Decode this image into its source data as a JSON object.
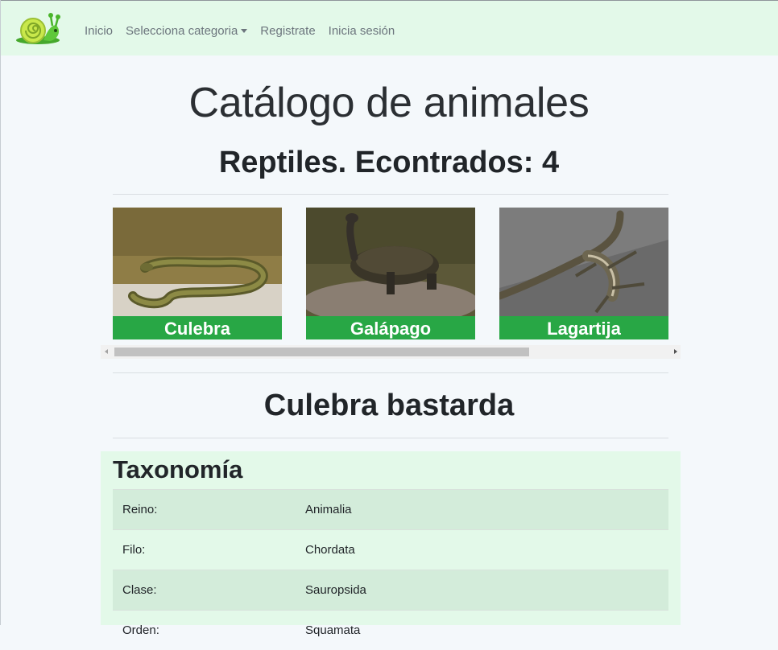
{
  "nav": {
    "links": [
      "Inicio",
      "Selecciona categoria",
      "Registrate",
      "Inicia sesión"
    ]
  },
  "page": {
    "title": "Catálogo de animales",
    "subtitle": "Reptiles. Econtrados: 4"
  },
  "gallery": {
    "cards": [
      {
        "label": "Culebra",
        "icon": "snake-photo"
      },
      {
        "label": "Galápago",
        "icon": "turtle-photo"
      },
      {
        "label": "Lagartija",
        "icon": "lizard-photo"
      }
    ]
  },
  "animal": {
    "name": "Culebra bastarda"
  },
  "taxonomy": {
    "title": "Taxonomía",
    "rows": [
      {
        "key": "Reino:",
        "value": "Animalia"
      },
      {
        "key": "Filo:",
        "value": "Chordata"
      },
      {
        "key": "Clase:",
        "value": "Sauropsida"
      },
      {
        "key": "Orden:",
        "value": "Squamata"
      }
    ]
  },
  "colors": {
    "navbar_bg": "#e3f9e9",
    "card_label_bg": "#28a745",
    "page_bg": "#f4f8fb"
  }
}
